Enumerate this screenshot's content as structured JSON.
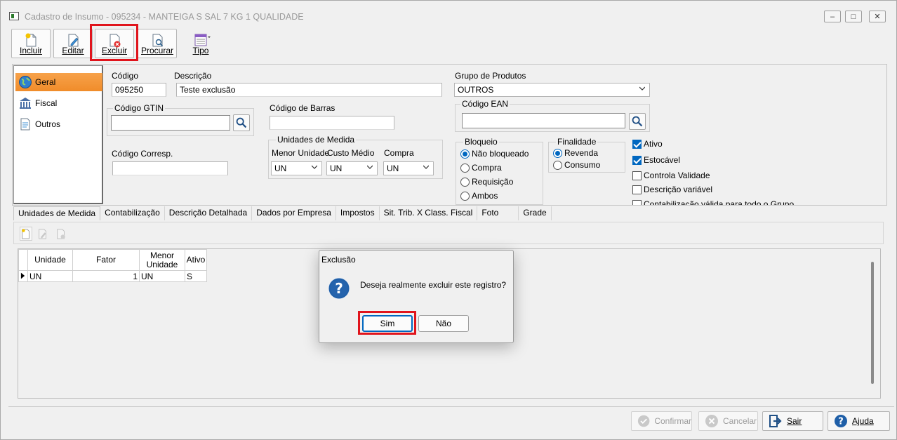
{
  "window": {
    "title": "Cadastro de Insumo - 095234 - MANTEIGA S  SAL 7 KG  1  QUALIDADE",
    "minimize_glyph": "–",
    "maximize_glyph": "□",
    "close_glyph": "✕"
  },
  "toolbar": {
    "incluir_label": "Incluir",
    "editar_label": "Editar",
    "excluir_label": "Excluir",
    "procurar_label": "Procurar",
    "tipo_label": "Tipo"
  },
  "sidebar": {
    "items": [
      {
        "label": "Geral",
        "icon": "globe-icon"
      },
      {
        "label": "Fiscal",
        "icon": "bank-icon"
      },
      {
        "label": "Outros",
        "icon": "document-icon"
      }
    ]
  },
  "form": {
    "codigo_label": "Código",
    "codigo_value": "095250",
    "descricao_label": "Descrição",
    "descricao_value": "Teste exclusão",
    "grupo_label": "Grupo de Produtos",
    "grupo_value": "OUTROS",
    "gtin_label": "Código GTIN",
    "gtin_value": "",
    "barras_label": "Código de Barras",
    "barras_value": "",
    "ean_label": "Código EAN",
    "ean_value": "",
    "corresp_label": "Código Corresp.",
    "corresp_value": "",
    "unidades_label": "Unidades de Medida",
    "menor_unidade_label": "Menor Unidade",
    "menor_unidade_value": "UN",
    "custo_medio_label": "Custo Médio",
    "custo_medio_value": "UN",
    "compra_label": "Compra",
    "compra_value": "UN",
    "bloqueio_label": "Bloqueio",
    "bloqueio_options": [
      "Não bloqueado",
      "Compra",
      "Requisição",
      "Ambos"
    ],
    "finalidade_label": "Finalidade",
    "finalidade_options": [
      "Revenda",
      "Consumo"
    ],
    "checks": [
      {
        "label": "Ativo",
        "checked": true
      },
      {
        "label": "Estocável",
        "checked": true
      },
      {
        "label": "Controla Validade",
        "checked": false
      },
      {
        "label": "Descrição variável",
        "checked": false
      },
      {
        "label": "Contabilização válida para todo o Grupo",
        "checked": false
      }
    ]
  },
  "tabs": [
    "Unidades de Medida",
    "Contabilização",
    "Descrição Detalhada",
    "Dados por Empresa",
    "Impostos",
    "Sit. Trib. X Class. Fiscal",
    "Foto",
    "Grade"
  ],
  "grid": {
    "headers": [
      "Unidade",
      "Fator",
      "Menor Unidade",
      "Ativo"
    ],
    "rows": [
      {
        "unidade": "UN",
        "fator": "1",
        "menor": "UN",
        "ativo": "S"
      }
    ]
  },
  "bottom": {
    "confirmar": "Confirmar",
    "cancelar": "Cancelar",
    "sair": "Sair",
    "ajuda": "Ajuda"
  },
  "dialog": {
    "title": "Exclusão",
    "message": "Deseja realmente excluir este registro?",
    "sim_label": "Sim",
    "nao_label": "Não"
  },
  "colors": {
    "accent": "#0067c0",
    "highlight_red": "#e0141c",
    "active_tab_orange": "#f08c2a"
  }
}
